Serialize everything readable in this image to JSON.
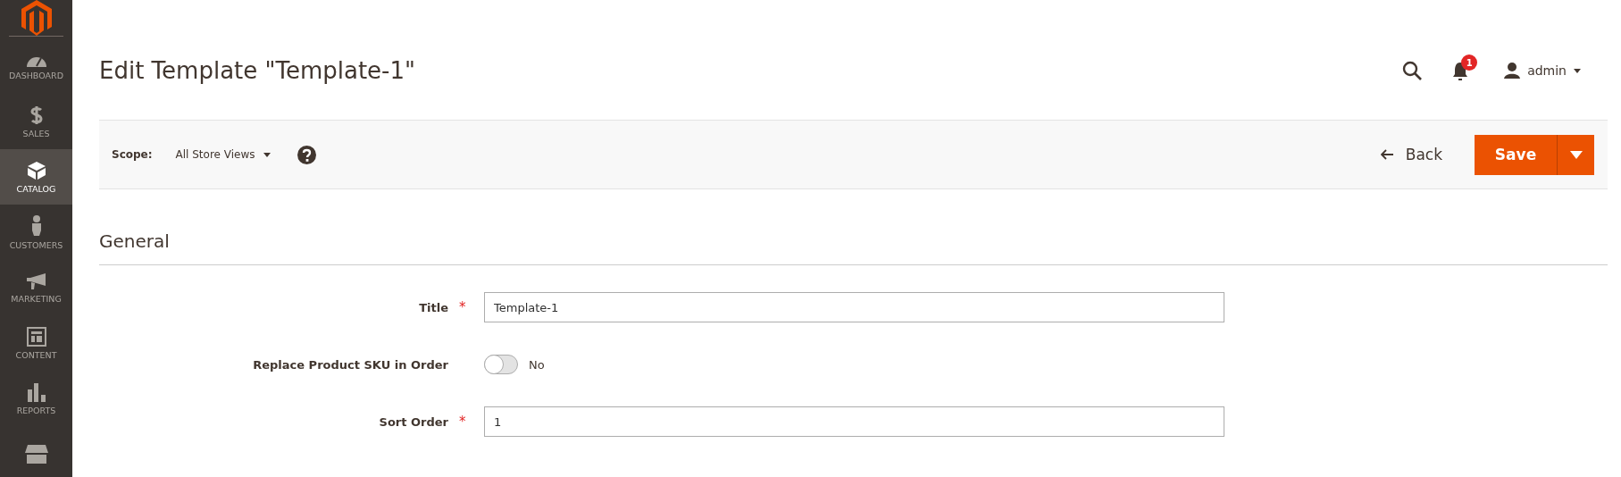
{
  "sidebar": {
    "items": [
      {
        "kind": "dashboard",
        "label": "DASHBOARD",
        "selected": false
      },
      {
        "kind": "sales",
        "label": "SALES",
        "selected": false
      },
      {
        "kind": "catalog",
        "label": "CATALOG",
        "selected": true
      },
      {
        "kind": "customers",
        "label": "CUSTOMERS",
        "selected": false
      },
      {
        "kind": "marketing",
        "label": "MARKETING",
        "selected": false
      },
      {
        "kind": "content",
        "label": "CONTENT",
        "selected": false
      },
      {
        "kind": "reports",
        "label": "REPORTS",
        "selected": false
      },
      {
        "kind": "stores",
        "selected": false
      }
    ]
  },
  "header": {
    "title": "Edit Template \"Template-1\"",
    "notifications": "1",
    "user": "admin"
  },
  "toolbar": {
    "scope_label": "Scope:",
    "scope_value": "All Store Views",
    "back": "Back",
    "save": "Save"
  },
  "section": {
    "title": "General"
  },
  "fields": [
    {
      "kind": "text",
      "label": "Title",
      "required_mark": "*",
      "value": "Template-1"
    },
    {
      "kind": "toggle",
      "label": "Replace Product SKU in Order",
      "on": false,
      "state_text": "No"
    },
    {
      "kind": "text",
      "label": "Sort Order",
      "required_mark": "*",
      "value": "1"
    }
  ]
}
